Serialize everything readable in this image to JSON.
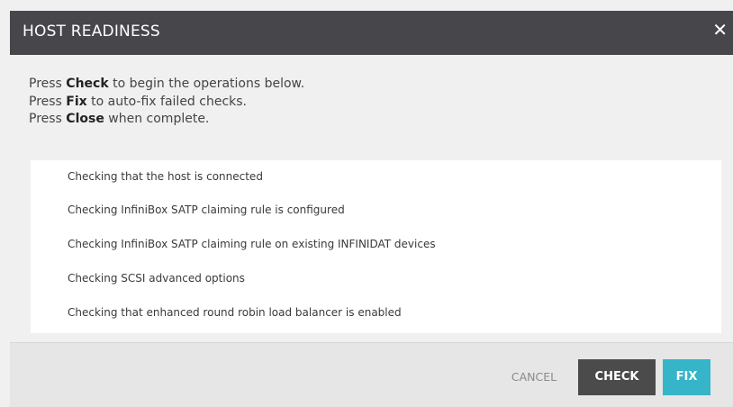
{
  "dialog": {
    "title": "HOST READINESS",
    "close_glyph": "✕"
  },
  "intro": {
    "lines": [
      {
        "prefix": "Press ",
        "keyword": "Check",
        "suffix": " to begin the operations below."
      },
      {
        "prefix": "Press ",
        "keyword": "Fix",
        "suffix": " to auto-fix failed checks."
      },
      {
        "prefix": "Press ",
        "keyword": "Close",
        "suffix": " when complete."
      }
    ]
  },
  "checks": [
    "Checking that the host is connected",
    "Checking InfiniBox SATP claiming rule is configured",
    "Checking InfiniBox SATP claiming rule on existing INFINIDAT devices",
    "Checking SCSI advanced options",
    "Checking that enhanced round robin load balancer is enabled"
  ],
  "footer": {
    "cancel_label": "CANCEL",
    "check_label": "CHECK",
    "fix_label": "FIX"
  },
  "colors": {
    "title_bar": "#46464b",
    "check_button": "#4b4b4b",
    "fix_button": "#36b4c8"
  }
}
